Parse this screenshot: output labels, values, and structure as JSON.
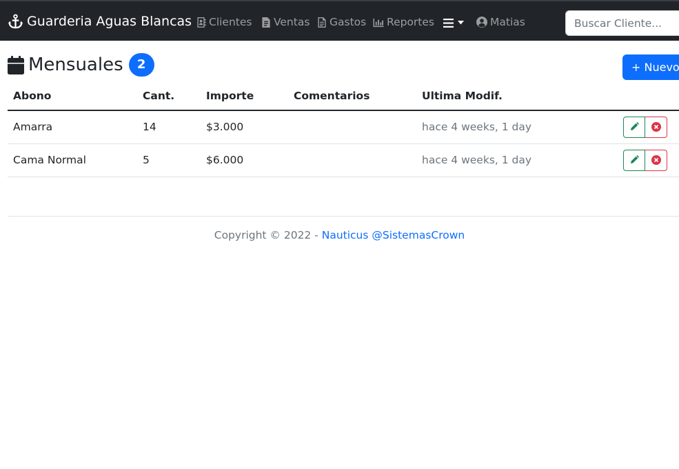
{
  "navbar": {
    "brand": "Guarderia Aguas Blancas",
    "links": [
      {
        "label": "Clientes",
        "icon": "address-book-icon"
      },
      {
        "label": "Ventas",
        "icon": "file-invoice-icon"
      },
      {
        "label": "Gastos",
        "icon": "file-document-icon"
      },
      {
        "label": "Reportes",
        "icon": "bar-chart-icon"
      }
    ],
    "menu_icon": "hamburger-menu-icon",
    "user": "Matias",
    "search_placeholder": "Buscar Cliente..."
  },
  "page": {
    "title": "Mensuales",
    "count": "2",
    "new_button": "+ Nuevo"
  },
  "table": {
    "headers": [
      "Abono",
      "Cant.",
      "Importe",
      "Comentarios",
      "Ultima Modif."
    ],
    "rows": [
      {
        "abono": "Amarra",
        "cant": "14",
        "importe": "$3.000",
        "comentarios": "",
        "modif": "hace 4 weeks, 1 day"
      },
      {
        "abono": "Cama Normal",
        "cant": "5",
        "importe": "$6.000",
        "comentarios": "",
        "modif": "hace 4 weeks, 1 day"
      }
    ]
  },
  "footer": {
    "text": "Copyright © 2022 - ",
    "link": "Nauticus @SistemasCrown"
  },
  "colors": {
    "navbar": "#212529",
    "primary": "#0d6efd",
    "success": "#198754",
    "danger": "#dc3545"
  }
}
